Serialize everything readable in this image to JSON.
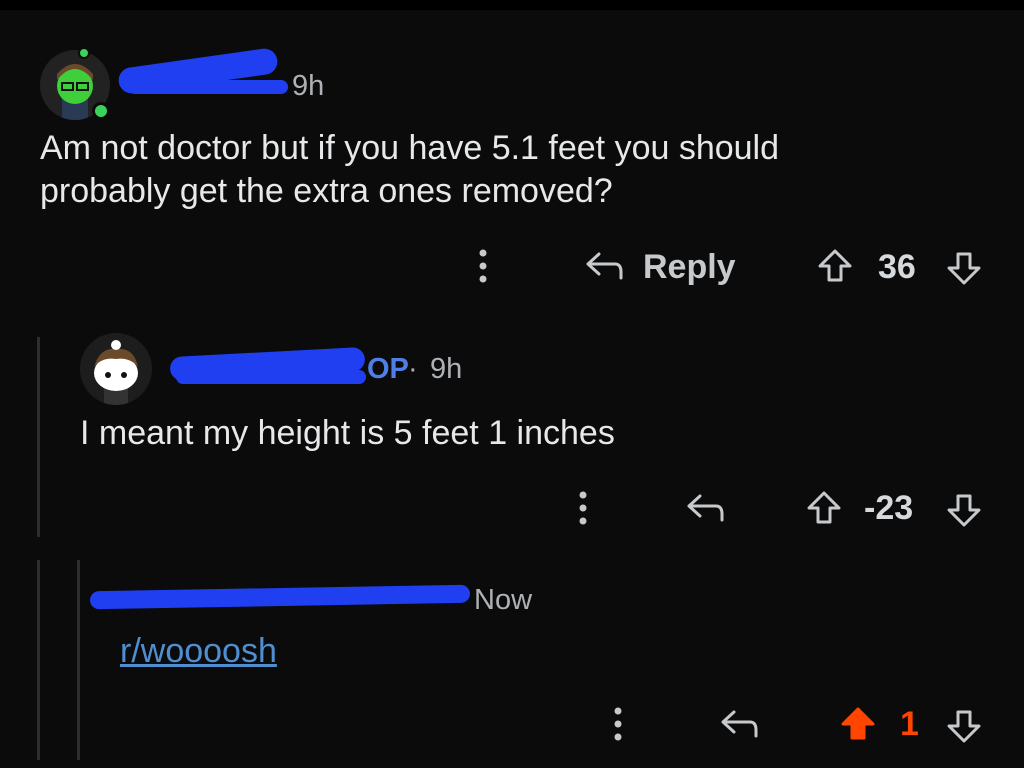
{
  "comments": [
    {
      "time": "9h",
      "text_line1": "Am not doctor but if you have 5.1 feet you should",
      "text_line2": "probably get the extra ones removed?",
      "reply_label": "Reply",
      "score": "36"
    },
    {
      "op_badge": "OP",
      "separator": "·",
      "time": "9h",
      "text": "I meant my height is 5 feet 1 inches",
      "score": "-23"
    },
    {
      "time": "Now",
      "link_text": "r/woooosh",
      "score": "1"
    }
  ],
  "colors": {
    "background": "#0b0b0b",
    "redaction": "#1f3ff0",
    "upvote_active": "#ff4500",
    "link": "#4f8fd1",
    "online": "#3bd15a"
  }
}
